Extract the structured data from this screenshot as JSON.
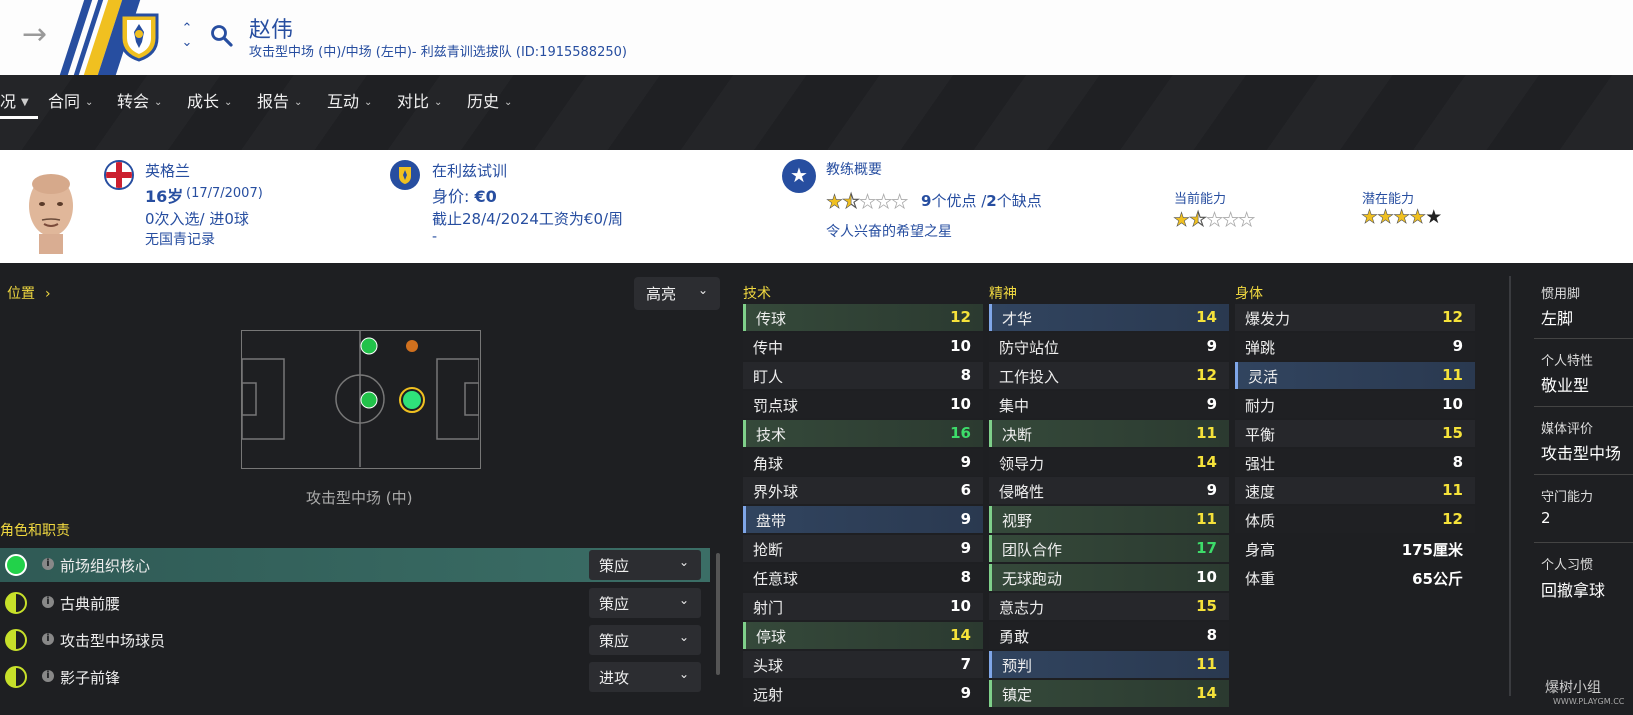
{
  "header": {
    "player_name": "赵伟",
    "player_subtitle": "攻击型中场 (中)/中场 (左中)- 利兹青训选拔队 (ID:1915588250)"
  },
  "nav": {
    "tabs": [
      {
        "label": "况",
        "active": true
      },
      {
        "label": "合同"
      },
      {
        "label": "转会"
      },
      {
        "label": "成长"
      },
      {
        "label": "报告"
      },
      {
        "label": "互动"
      },
      {
        "label": "对比"
      },
      {
        "label": "历史"
      }
    ]
  },
  "info": {
    "nationality": "英格兰",
    "age": "16岁",
    "dob": "(17/7/2007)",
    "caps": "0次入选/ 进0球",
    "youth": "无国青记录",
    "club_status": "在利兹试训",
    "value_label": "身价: ",
    "value": "€0",
    "wage": "截止28/4/2024工资为€0/周",
    "dash": "-",
    "coach_title": "教练概要",
    "strengths": "9",
    "strengths_label": "个优点 /",
    "weaknesses": "2",
    "weaknesses_label": "个缺点",
    "coach_comment": "令人兴奋的希望之星",
    "coach_stars": 1.5,
    "current_ability_label": "当前能力",
    "current_ability_stars": 1.5,
    "potential_ability_label": "潜在能力",
    "potential_ability_stars": 4.0
  },
  "position": {
    "link": "位置",
    "highlight": "高亮",
    "caption": "攻击型中场 (中)"
  },
  "roles": {
    "title": "角色和职责",
    "items": [
      {
        "name": "前场组织核心",
        "duty": "策应",
        "dot": "full",
        "active": true
      },
      {
        "name": "古典前腰",
        "duty": "策应",
        "dot": "half"
      },
      {
        "name": "攻击型中场球员",
        "duty": "策应",
        "dot": "half"
      },
      {
        "name": "影子前锋",
        "duty": "进攻",
        "dot": "half"
      }
    ]
  },
  "attributes": {
    "technical_title": "技术",
    "mental_title": "精神",
    "physical_title": "身体",
    "technical": [
      {
        "name": "传球",
        "value": "12",
        "hl": "green"
      },
      {
        "name": "传中",
        "value": "10"
      },
      {
        "name": "盯人",
        "value": "8"
      },
      {
        "name": "罚点球",
        "value": "10"
      },
      {
        "name": "技术",
        "value": "16",
        "hl": "green"
      },
      {
        "name": "角球",
        "value": "9"
      },
      {
        "name": "界外球",
        "value": "6"
      },
      {
        "name": "盘带",
        "value": "9",
        "hl": "blue"
      },
      {
        "name": "抢断",
        "value": "9"
      },
      {
        "name": "任意球",
        "value": "8"
      },
      {
        "name": "射门",
        "value": "10"
      },
      {
        "name": "停球",
        "value": "14",
        "hl": "green"
      },
      {
        "name": "头球",
        "value": "7"
      },
      {
        "name": "远射",
        "value": "9"
      }
    ],
    "mental": [
      {
        "name": "才华",
        "value": "14",
        "hl": "blue"
      },
      {
        "name": "防守站位",
        "value": "9"
      },
      {
        "name": "工作投入",
        "value": "12"
      },
      {
        "name": "集中",
        "value": "9"
      },
      {
        "name": "决断",
        "value": "11",
        "hl": "green"
      },
      {
        "name": "领导力",
        "value": "14"
      },
      {
        "name": "侵略性",
        "value": "9"
      },
      {
        "name": "视野",
        "value": "11",
        "hl": "green"
      },
      {
        "name": "团队合作",
        "value": "17",
        "hl": "green"
      },
      {
        "name": "无球跑动",
        "value": "10",
        "hl": "green"
      },
      {
        "name": "意志力",
        "value": "15"
      },
      {
        "name": "勇敢",
        "value": "8"
      },
      {
        "name": "预判",
        "value": "11",
        "hl": "blue"
      },
      {
        "name": "镇定",
        "value": "14",
        "hl": "green"
      }
    ],
    "physical": [
      {
        "name": "爆发力",
        "value": "12"
      },
      {
        "name": "弹跳",
        "value": "9"
      },
      {
        "name": "灵活",
        "value": "11",
        "hl": "blue"
      },
      {
        "name": "耐力",
        "value": "10"
      },
      {
        "name": "平衡",
        "value": "15"
      },
      {
        "name": "强壮",
        "value": "8"
      },
      {
        "name": "速度",
        "value": "11"
      },
      {
        "name": "体质",
        "value": "12"
      },
      {
        "name": "身高",
        "value": "175厘米",
        "plain": true
      },
      {
        "name": "体重",
        "value": "65公斤",
        "plain": true
      }
    ]
  },
  "side": {
    "foot_label": "惯用脚",
    "foot_value": "左脚",
    "trait_label": "个人特性",
    "trait_value": "敬业型",
    "media_label": "媒体评价",
    "media_value": "攻击型中场",
    "gk_label": "守门能力",
    "gk_value": "2",
    "habit_label": "个人习惯",
    "habit_value": "回撤拿球"
  },
  "watermark": {
    "text": "爆树小组",
    "url": "WWW.PLAYGM.CC"
  },
  "colors": {
    "header_blue": "#274ea0",
    "accent_yellow": "#f0d840",
    "value_green": "#3ddc6a",
    "value_yellow": "#f5e23a"
  }
}
